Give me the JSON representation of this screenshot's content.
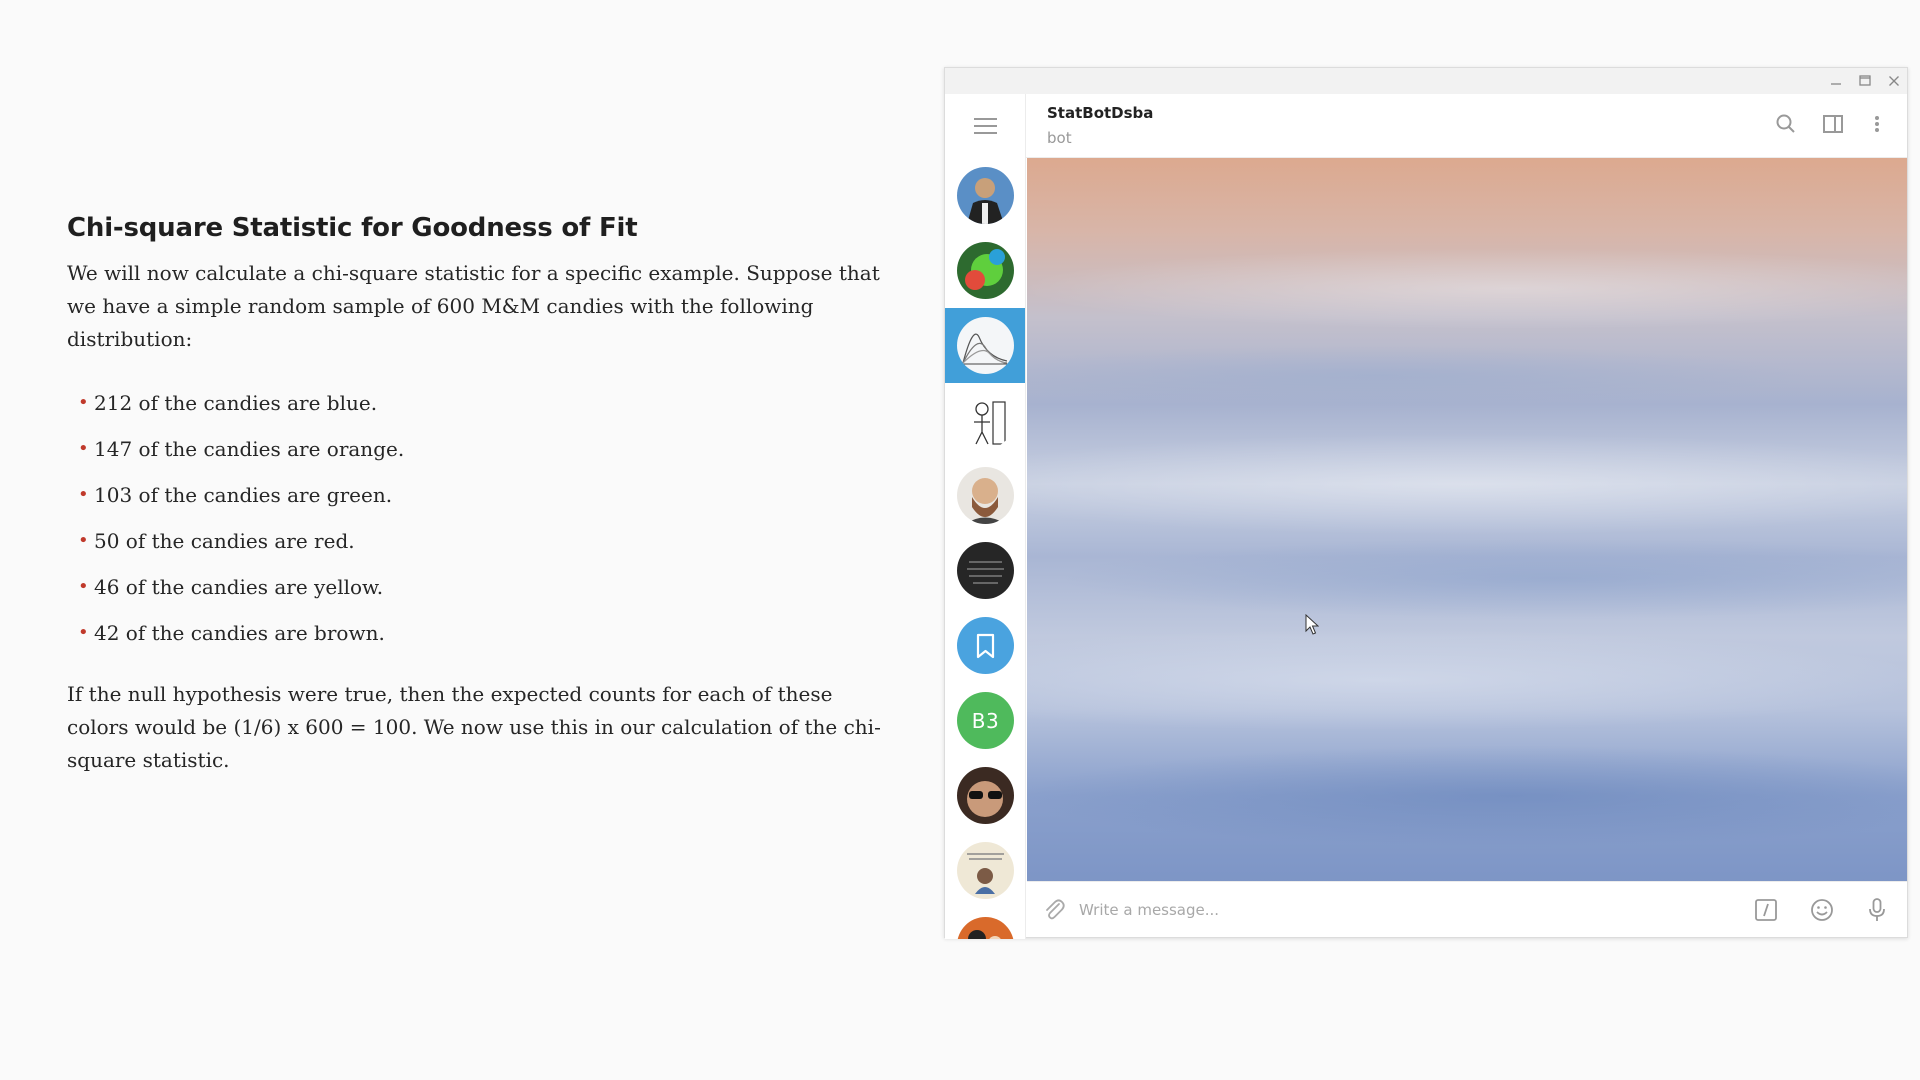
{
  "article": {
    "heading": "Chi-square Statistic for Goodness of Fit",
    "intro": "We will now calculate a chi-square statistic for a specific example. Suppose that we have a simple random sample of 600 M&M candies with the following distribution:",
    "items": [
      "212 of the candies are blue.",
      "147 of the candies are orange.",
      "103 of the candies are green.",
      "50 of the candies are red.",
      "46 of the candies are yellow.",
      "42 of the candies are brown."
    ],
    "conclusion": "If the null hypothesis were true, then the expected counts for each of these colors would be (1/6) x 600 = 100. We now use this in our calculation of the chi-square statistic."
  },
  "telegram": {
    "chat": {
      "title": "StatBotDsba",
      "status": "bot"
    },
    "composer": {
      "placeholder": "Write a message..."
    },
    "sidebar": {
      "active_index": 2,
      "chats": [
        {
          "icon": "user-avatar-1"
        },
        {
          "icon": "user-avatar-2"
        },
        {
          "icon": "statbot-avatar"
        },
        {
          "icon": "sketch-avatar"
        },
        {
          "icon": "user-avatar-5"
        },
        {
          "icon": "dark-text-avatar"
        },
        {
          "icon": "saved-messages-icon"
        },
        {
          "initials": "B3"
        },
        {
          "icon": "user-avatar-9"
        },
        {
          "icon": "user-avatar-10"
        },
        {
          "icon": "user-avatar-11"
        }
      ]
    },
    "colors": {
      "accent": "#419fd9",
      "saved": "#4aa3df",
      "b3": "#4fba5c",
      "bullet": "#c0392b"
    }
  }
}
